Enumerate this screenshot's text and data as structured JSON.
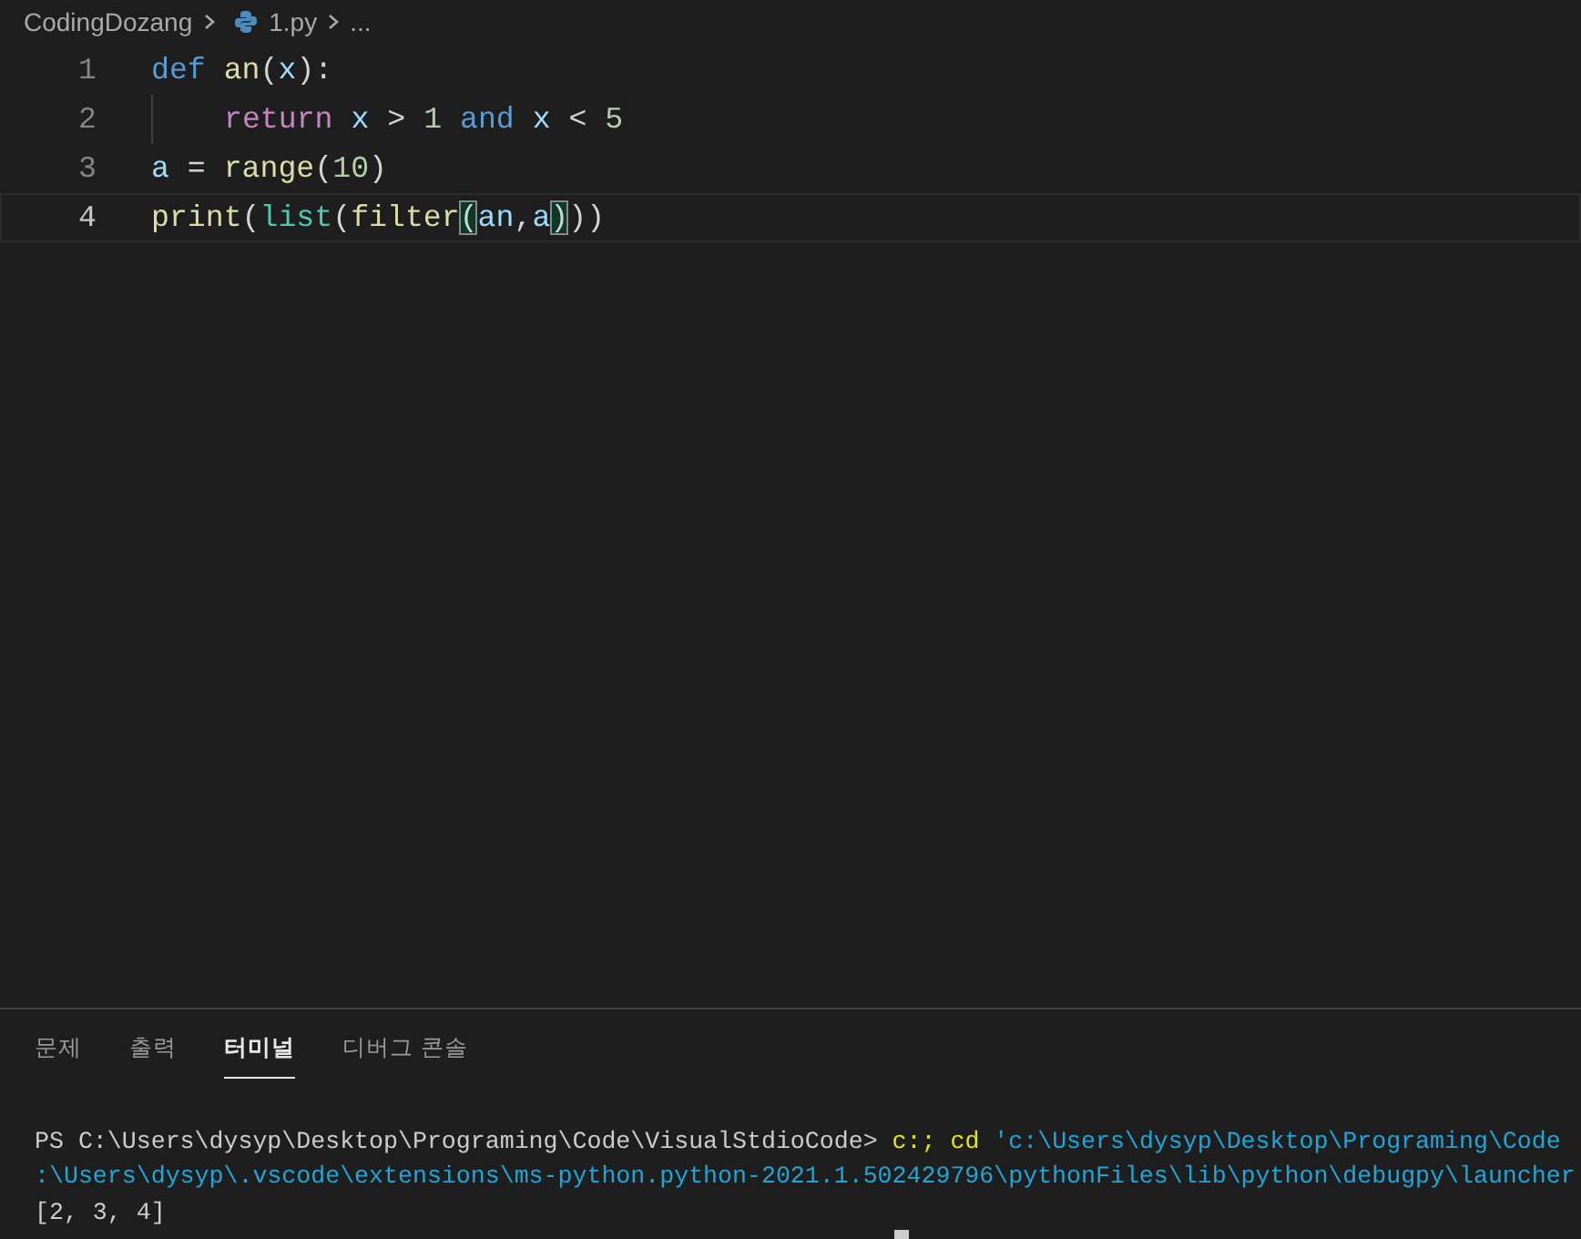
{
  "breadcrumb": [
    {
      "label": "CodingDozang",
      "kind": "folder"
    },
    {
      "label": "1.py",
      "kind": "python-file"
    },
    {
      "label": "...",
      "kind": "more"
    }
  ],
  "editor": {
    "lines": [
      {
        "number": "1",
        "current": false,
        "tokens": [
          {
            "text": "def ",
            "kind": "keyword"
          },
          {
            "text": "an",
            "kind": "function"
          },
          {
            "text": "(",
            "kind": "plain"
          },
          {
            "text": "x",
            "kind": "variable"
          },
          {
            "text": "):",
            "kind": "plain"
          }
        ],
        "children": [
          {
            "number": "2",
            "current": false,
            "tokens": [
              {
                "text": "return ",
                "kind": "control"
              },
              {
                "text": "x",
                "kind": "variable"
              },
              {
                "text": " > ",
                "kind": "plain"
              },
              {
                "text": "1 ",
                "kind": "number"
              },
              {
                "text": "and ",
                "kind": "keyword"
              },
              {
                "text": "x",
                "kind": "variable"
              },
              {
                "text": " < ",
                "kind": "plain"
              },
              {
                "text": "5",
                "kind": "number"
              }
            ]
          }
        ]
      },
      {
        "number": "3",
        "current": false,
        "tokens": [
          {
            "text": "a",
            "kind": "variable"
          },
          {
            "text": " = ",
            "kind": "plain"
          },
          {
            "text": "range",
            "kind": "function"
          },
          {
            "text": "(",
            "kind": "plain"
          },
          {
            "text": "10",
            "kind": "number"
          },
          {
            "text": ")",
            "kind": "plain"
          }
        ]
      },
      {
        "number": "4",
        "current": true,
        "tokens": [
          {
            "text": "print",
            "kind": "function"
          },
          {
            "text": "(",
            "kind": "plain"
          },
          {
            "text": "list",
            "kind": "class"
          },
          {
            "text": "(",
            "kind": "plain"
          },
          {
            "text": "filter",
            "kind": "function"
          },
          {
            "text": "(",
            "kind": "plain",
            "matched": true
          },
          {
            "text": "an",
            "kind": "variable"
          },
          {
            "text": ",",
            "kind": "plain"
          },
          {
            "text": "a",
            "kind": "variable"
          },
          {
            "text": ")",
            "kind": "plain",
            "matched": true
          },
          {
            "text": "))",
            "kind": "plain"
          }
        ]
      }
    ]
  },
  "panel": {
    "tabs": [
      {
        "label": "문제",
        "selected": false
      },
      {
        "label": "출력",
        "selected": false
      },
      {
        "label": "터미널",
        "selected": true
      },
      {
        "label": "디버그 콘솔",
        "selected": false
      }
    ],
    "terminal": [
      [
        {
          "text": "PS C:\\Users\\dysyp\\Desktop\\Programing\\Code\\VisualStdioCode> ",
          "kind": "plain"
        },
        {
          "text": "c:; cd ",
          "kind": "command"
        },
        {
          "text": "'c:\\Users\\dysyp\\Desktop\\Programing\\Code",
          "kind": "string"
        }
      ],
      [
        {
          "text": ":\\Users\\dysyp\\.vscode\\extensions\\ms-python.python-2021.1.502429796\\pythonFiles\\lib\\python\\debugpy\\launcher",
          "kind": "string"
        }
      ],
      [
        {
          "text": "[2, 3, 4]",
          "kind": "plain"
        }
      ]
    ]
  }
}
